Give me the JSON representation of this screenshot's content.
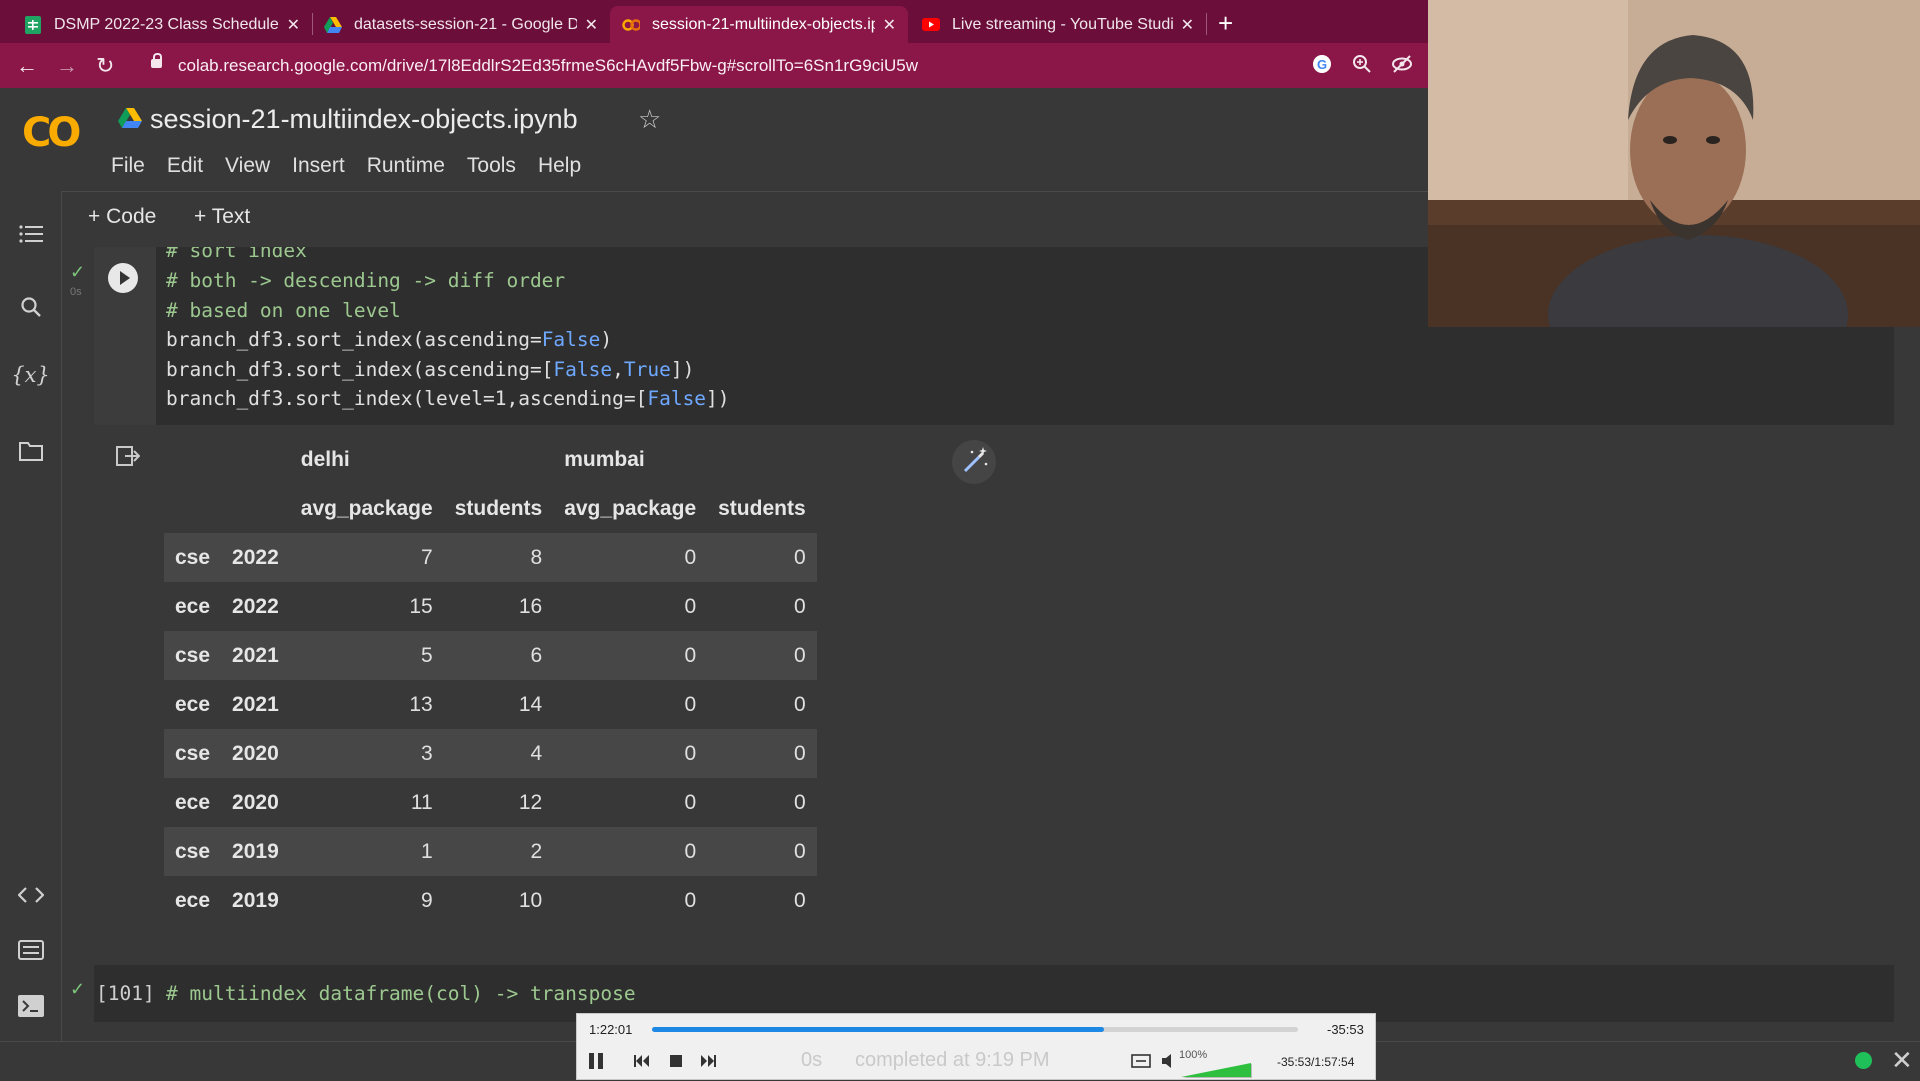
{
  "browser": {
    "tabs": [
      {
        "title": "DSMP 2022-23 Class Schedule - ",
        "icon": "sheets-icon",
        "active": false
      },
      {
        "title": "datasets-session-21 - Google Dr",
        "icon": "drive-icon",
        "active": false
      },
      {
        "title": "session-21-multiindex-objects.ip",
        "icon": "colab-icon",
        "active": true
      },
      {
        "title": "Live streaming - YouTube Studio",
        "icon": "youtube-icon",
        "active": false
      }
    ],
    "url": "colab.research.google.com/drive/17l8EddlrS2Ed35frmeS6cHAvdf5Fbw-g#scrollTo=6Sn1rG9ciU5w",
    "new_tab_symbol": "+"
  },
  "colab": {
    "logo": "CO",
    "notebook_title": "session-21-multiindex-objects.ipynb",
    "menu": [
      "File",
      "Edit",
      "View",
      "Insert",
      "Runtime",
      "Tools",
      "Help"
    ],
    "toolbar": {
      "add_code": "+ Code",
      "add_text": "+ Text"
    },
    "sidebar_icons": [
      "toc-icon",
      "search-icon",
      "variables-icon",
      "files-icon",
      "code-snippets-icon",
      "command-palette-icon",
      "terminal-icon"
    ],
    "variables_label": "{x}"
  },
  "cell": {
    "exec_time": "0s",
    "lines": [
      {
        "parts": [
          {
            "t": "# sort index",
            "c": "cm"
          }
        ]
      },
      {
        "parts": [
          {
            "t": "# both -> descending -> diff order",
            "c": "cm"
          }
        ]
      },
      {
        "parts": [
          {
            "t": "# based on one level",
            "c": "cm"
          }
        ]
      },
      {
        "parts": [
          {
            "t": "branch_df3.sort_index(ascending=",
            "c": ""
          },
          {
            "t": "False",
            "c": "kw"
          },
          {
            "t": ")",
            "c": ""
          }
        ]
      },
      {
        "parts": [
          {
            "t": "branch_df3.sort_index(ascending=[",
            "c": ""
          },
          {
            "t": "False",
            "c": "kw"
          },
          {
            "t": ",",
            "c": ""
          },
          {
            "t": "True",
            "c": "kw"
          },
          {
            "t": "])",
            "c": ""
          }
        ]
      },
      {
        "parts": [
          {
            "t": "branch_df3.sort_index(level=1,ascending=[",
            "c": ""
          },
          {
            "t": "False",
            "c": "kw"
          },
          {
            "t": "])",
            "c": ""
          }
        ]
      }
    ]
  },
  "dataframe": {
    "top_headers": [
      "delhi",
      "mumbai"
    ],
    "sub_headers": [
      "avg_package",
      "students",
      "avg_package",
      "students"
    ],
    "rows": [
      {
        "branch": "cse",
        "year": "2022",
        "values": [
          "7",
          "8",
          "0",
          "0"
        ]
      },
      {
        "branch": "ece",
        "year": "2022",
        "values": [
          "15",
          "16",
          "0",
          "0"
        ]
      },
      {
        "branch": "cse",
        "year": "2021",
        "values": [
          "5",
          "6",
          "0",
          "0"
        ]
      },
      {
        "branch": "ece",
        "year": "2021",
        "values": [
          "13",
          "14",
          "0",
          "0"
        ]
      },
      {
        "branch": "cse",
        "year": "2020",
        "values": [
          "3",
          "4",
          "0",
          "0"
        ]
      },
      {
        "branch": "ece",
        "year": "2020",
        "values": [
          "11",
          "12",
          "0",
          "0"
        ]
      },
      {
        "branch": "cse",
        "year": "2019",
        "values": [
          "1",
          "2",
          "0",
          "0"
        ]
      },
      {
        "branch": "ece",
        "year": "2019",
        "values": [
          "9",
          "10",
          "0",
          "0"
        ]
      }
    ]
  },
  "next_cell": {
    "label": "[101]",
    "code": "# multiindex dataframe(col) -> transpose"
  },
  "player": {
    "elapsed": "1:22:01",
    "remaining": "-35:53",
    "progress": 0.7,
    "zero_label": "0s",
    "status": "completed at 9:19 PM",
    "volume_label": "100%",
    "total": "-35:53/1:57:54"
  },
  "colors": {
    "tabstrip": "#6b0f3a",
    "addressbar": "#8a1748",
    "colab_orange": "#f9ab00",
    "connected": "#1fc05a"
  }
}
